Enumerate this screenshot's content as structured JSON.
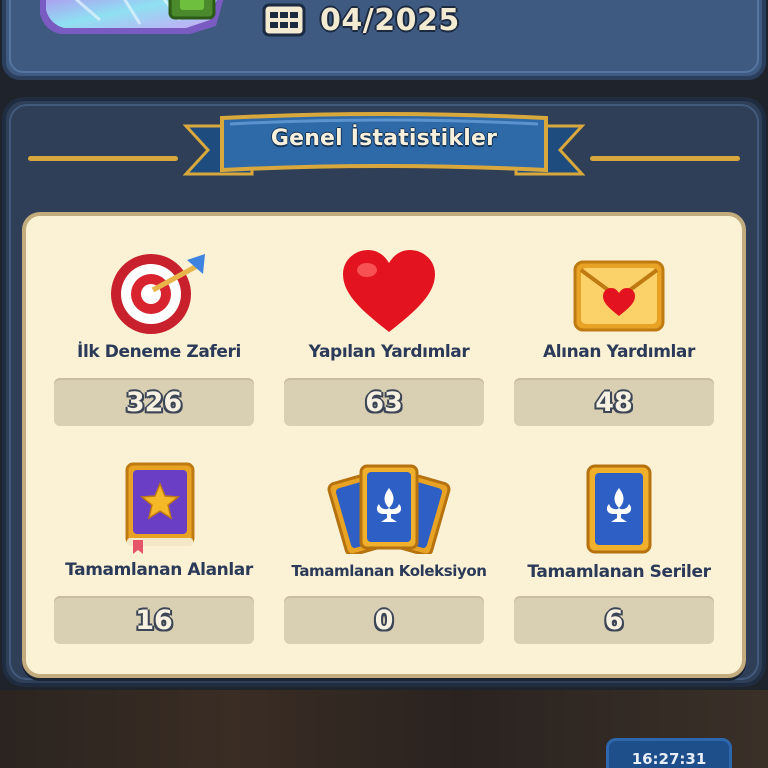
{
  "header": {
    "date": "04/2025"
  },
  "section": {
    "title": "Genel İstatistikler"
  },
  "stats": [
    {
      "label": "İlk Deneme Zaferi",
      "value": "326",
      "icon": "target-arrow-icon"
    },
    {
      "label": "Yapılan Yardımlar",
      "value": "63",
      "icon": "heart-icon"
    },
    {
      "label": "Alınan Yardımlar",
      "value": "48",
      "icon": "heart-envelope-icon"
    },
    {
      "label": "Tamamlanan Alanlar",
      "value": "16",
      "icon": "star-book-icon"
    },
    {
      "label": "Tamamlanan Koleksiyon",
      "value": "0",
      "icon": "fleur-cards-fan-icon"
    },
    {
      "label": "Tamamlanan Seriler",
      "value": "6",
      "icon": "fleur-card-icon"
    }
  ],
  "footer": {
    "time": "16:27:31"
  },
  "colors": {
    "panel": "#2e3f57",
    "card": "#fbf2d5",
    "banner": "#2f6aa8",
    "gold": "#d9a83c",
    "label_text": "#2a3a58"
  }
}
